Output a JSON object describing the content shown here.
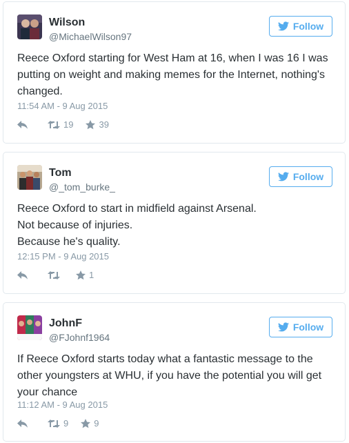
{
  "tweets": [
    {
      "name": "Wilson",
      "handle": "@MichaelWilson97",
      "follow_label": "Follow",
      "text": [
        "Reece Oxford starting for West Ham at 16, when I was 16 I was putting on weight and making memes for the Internet, nothing's changed."
      ],
      "timestamp": "11:54 AM - 9 Aug 2015",
      "retweets": "19",
      "likes": "39"
    },
    {
      "name": "Tom",
      "handle": "@_tom_burke_",
      "follow_label": "Follow",
      "text": [
        "Reece Oxford to start in midfield against Arsenal.",
        "Not because of injuries.",
        "Because he's quality."
      ],
      "timestamp": "12:15 PM - 9 Aug 2015",
      "retweets": "",
      "likes": "1"
    },
    {
      "name": "JohnF",
      "handle": "@FJohnf1964",
      "follow_label": "Follow",
      "text": [
        "If Reece Oxford starts today what a fantastic message to the other youngsters at WHU, if you have the potential you will get your chance"
      ],
      "timestamp": "11:12 AM - 9 Aug 2015",
      "retweets": "9",
      "likes": "9"
    }
  ],
  "colors": {
    "accent": "#55acee",
    "muted": "#8899a6",
    "border": "#e1e8ed",
    "text": "#292f33"
  },
  "icons": [
    "twitter-bird-icon",
    "reply-icon",
    "retweet-icon",
    "star-icon"
  ]
}
